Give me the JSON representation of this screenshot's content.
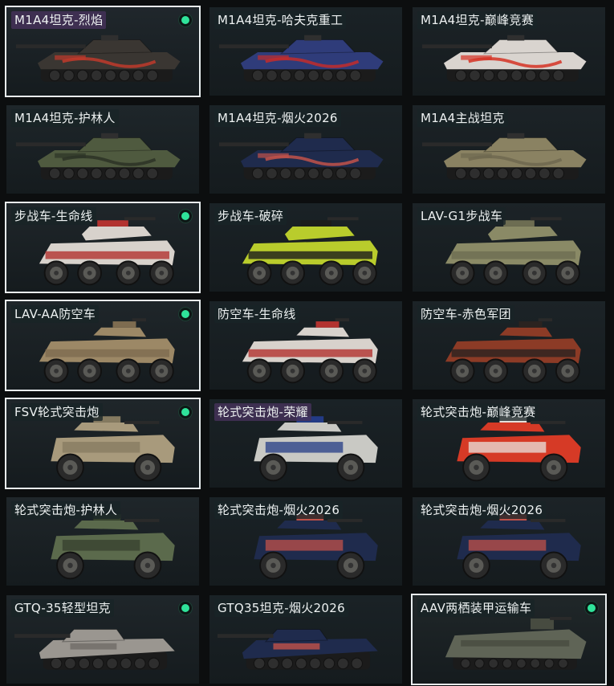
{
  "vehicles": [
    {
      "name": "M1A4坦克-烈焰",
      "selected": true,
      "owned": true,
      "type": "tank",
      "body": "#3a3632",
      "accent": "#c0392b",
      "label_style": "purple",
      "bg": "#20272c"
    },
    {
      "name": "M1A4坦克-哈夫克重工",
      "selected": false,
      "owned": false,
      "type": "tank",
      "body": "#2f3c7a",
      "accent": "#c22c2c",
      "label_style": "",
      "bg": "#1a2226"
    },
    {
      "name": "M1A4坦克-巅峰竞赛",
      "selected": false,
      "owned": false,
      "type": "tank",
      "body": "#d9d4cf",
      "accent": "#d53325",
      "label_style": "",
      "bg": "#1c2327"
    },
    {
      "name": "M1A4坦克-护林人",
      "selected": false,
      "owned": false,
      "type": "tank",
      "body": "#4f5a3f",
      "accent": "#2c3326",
      "label_style": "",
      "bg": "#1e262a"
    },
    {
      "name": "M1A4坦克-烟火2026",
      "selected": false,
      "owned": false,
      "type": "tank",
      "body": "#1f2b4d",
      "accent": "#c2524a",
      "label_style": "",
      "bg": "#1a2226"
    },
    {
      "name": "M1A4主战坦克",
      "selected": false,
      "owned": false,
      "type": "tank",
      "body": "#8a8262",
      "accent": "#6e6850",
      "label_style": "",
      "bg": "#1c2327"
    },
    {
      "name": "步战车-生命线",
      "selected": true,
      "owned": true,
      "type": "ifv",
      "body": "#d8d2cc",
      "accent": "#b33330",
      "label_style": "",
      "bg": "#1f262a"
    },
    {
      "name": "步战车-破碎",
      "selected": false,
      "owned": false,
      "type": "ifv",
      "body": "#b9cc2c",
      "accent": "#1b1b1b",
      "label_style": "",
      "bg": "#1a2226"
    },
    {
      "name": "LAV-G1步战车",
      "selected": false,
      "owned": false,
      "type": "ifv",
      "body": "#8a8a66",
      "accent": "#6d6d52",
      "label_style": "",
      "bg": "#1c2327"
    },
    {
      "name": "LAV-AA防空车",
      "selected": true,
      "owned": true,
      "type": "aa",
      "body": "#9c8866",
      "accent": "#7e6c50",
      "label_style": "",
      "bg": "#1f262a"
    },
    {
      "name": "防空车-生命线",
      "selected": false,
      "owned": false,
      "type": "aa",
      "body": "#d8d2cc",
      "accent": "#b33330",
      "label_style": "",
      "bg": "#1a2226"
    },
    {
      "name": "防空车-赤色军团",
      "selected": false,
      "owned": false,
      "type": "aa",
      "body": "#8c3b26",
      "accent": "#2b2320",
      "label_style": "",
      "bg": "#1c2327"
    },
    {
      "name": "FSV轮式突击炮",
      "selected": true,
      "owned": true,
      "type": "fsv",
      "body": "#a89a7c",
      "accent": "#857a60",
      "label_style": "",
      "bg": "#1f262a"
    },
    {
      "name": "轮式突击炮-荣耀",
      "selected": false,
      "owned": false,
      "type": "fsv",
      "body": "#c9c9c4",
      "accent": "#233b86",
      "label_style": "purple",
      "bg": "#1a2226"
    },
    {
      "name": "轮式突击炮-巅峰竞赛",
      "selected": false,
      "owned": false,
      "type": "fsv",
      "body": "#d63a26",
      "accent": "#e8e4df",
      "label_style": "",
      "bg": "#1c2327"
    },
    {
      "name": "轮式突击炮-护林人",
      "selected": false,
      "owned": false,
      "type": "fsv",
      "body": "#5b6a4c",
      "accent": "#35402d",
      "label_style": "",
      "bg": "#1f262a"
    },
    {
      "name": "轮式突击炮-烟火2026",
      "selected": false,
      "owned": false,
      "type": "fsv",
      "body": "#1f2b4d",
      "accent": "#c2524a",
      "label_style": "",
      "bg": "#1a2226"
    },
    {
      "name": "轮式突击炮-烟火2026",
      "selected": false,
      "owned": false,
      "type": "fsv",
      "body": "#1f2b4d",
      "accent": "#c2524a",
      "label_style": "",
      "bg": "#1c2327"
    },
    {
      "name": "GTQ-35轻型坦克",
      "selected": false,
      "owned": true,
      "type": "light",
      "body": "#9a9690",
      "accent": "#6f6b66",
      "label_style": "",
      "bg": "#1f262a"
    },
    {
      "name": "GTQ35坦克-烟火2026",
      "selected": false,
      "owned": false,
      "type": "light",
      "body": "#1f2b4d",
      "accent": "#c2524a",
      "label_style": "",
      "bg": "#1a2226"
    },
    {
      "name": "AAV两栖装甲运输车",
      "selected": true,
      "owned": true,
      "type": "aav",
      "body": "#5f6456",
      "accent": "#474b40",
      "label_style": "",
      "bg": "#202729"
    }
  ],
  "badge_texts": {
    "2026": "2026"
  }
}
